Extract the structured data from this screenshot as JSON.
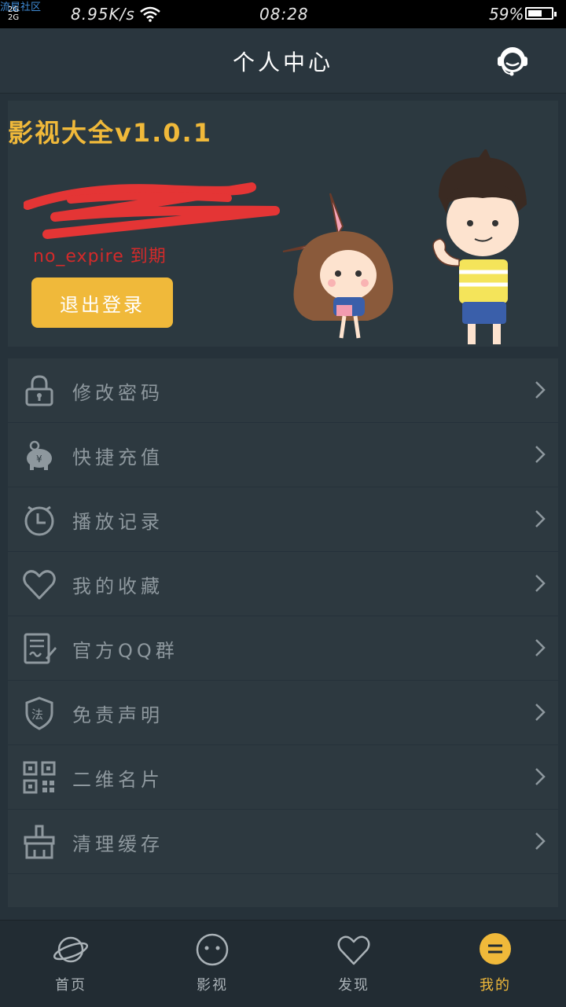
{
  "status_bar": {
    "watermark": "流星社区",
    "network": "2G",
    "speed": "8.95K/s",
    "time": "08:28",
    "battery_pct": "59%",
    "battery_level": 0.59
  },
  "header": {
    "title": "个人中心",
    "service_icon": "customer-service-icon"
  },
  "profile": {
    "app_version": "影视大全v1.0.1",
    "expire_text": "no_expire 到期",
    "logout_label": "退出登录"
  },
  "menu": {
    "items": [
      {
        "label": "修改密码",
        "icon": "lock-icon"
      },
      {
        "label": "快捷充值",
        "icon": "piggy-bank-icon"
      },
      {
        "label": "播放记录",
        "icon": "clock-icon"
      },
      {
        "label": "我的收藏",
        "icon": "heart-icon"
      },
      {
        "label": "官方QQ群",
        "icon": "document-edit-icon"
      },
      {
        "label": "免责声明",
        "icon": "law-shield-icon"
      },
      {
        "label": "二维名片",
        "icon": "qr-code-icon"
      },
      {
        "label": "清理缓存",
        "icon": "broom-icon"
      }
    ]
  },
  "bottom_nav": {
    "items": [
      {
        "label": "首页",
        "icon": "planet-icon",
        "active": false
      },
      {
        "label": "影视",
        "icon": "smiley-face-icon",
        "active": false
      },
      {
        "label": "发现",
        "icon": "heart-icon",
        "active": false
      },
      {
        "label": "我的",
        "icon": "menu-circle-icon",
        "active": true
      }
    ]
  },
  "colors": {
    "accent": "#f0b93a",
    "expire_red": "#d42a2a",
    "background": "#26323a"
  }
}
